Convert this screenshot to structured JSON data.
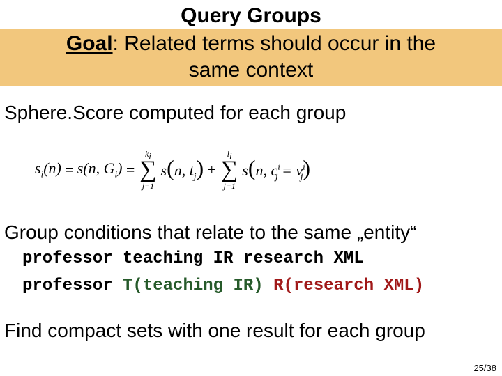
{
  "title": "Query Groups",
  "goal": {
    "label": "Goal",
    "sep": ": ",
    "text_line1": "Related terms should occur in the",
    "text_line2": "same context"
  },
  "line_sphere": "Sphere.Score computed for each group",
  "formula": {
    "lhs1": "s",
    "lhs1_sub": "i",
    "lhs_arg": "(n)",
    "eq": " = ",
    "mid": "s(n, G",
    "mid_sub": "i",
    "mid_close": ")",
    "sum1_top": "k",
    "sum1_top_sub": "i",
    "sum1_bot": "j=1",
    "term1": "s",
    "term1_arg_open": "(n, t",
    "term1_sub": "j",
    "term1_close": ")",
    "plus": " + ",
    "sum2_top": "l",
    "sum2_top_sub": "i",
    "sum2_bot": "j=1",
    "term2": "s",
    "term2_open": "(n, c",
    "term2_c_sub": "j",
    "term2_c_sup": "i",
    "term2_eq": " = v",
    "term2_v_sub": "j",
    "term2_v_sup": "i",
    "term2_close": ")"
  },
  "line_group": "Group conditions that relate to the same „entity“",
  "mono": {
    "line1": "professor teaching IR research XML",
    "line2_plain": "professor ",
    "line2_green": "T(teaching IR) ",
    "line2_red": "R(research XML)"
  },
  "line_final": "Find compact sets with one result for each group",
  "page": "25/38"
}
